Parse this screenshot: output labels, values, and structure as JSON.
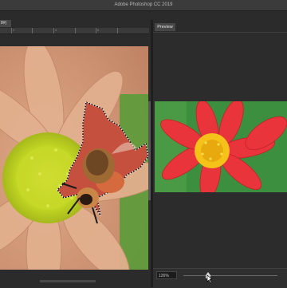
{
  "window": {
    "title": "Adobe Photoshop CC 2019"
  },
  "document": {
    "tab_label": "8#)"
  },
  "ruler": {
    "labels": [
      "2",
      "4",
      "6"
    ]
  },
  "preview": {
    "tab_label": "Preview"
  },
  "zoom": {
    "value": "126%",
    "slider_fraction": 0.25
  }
}
